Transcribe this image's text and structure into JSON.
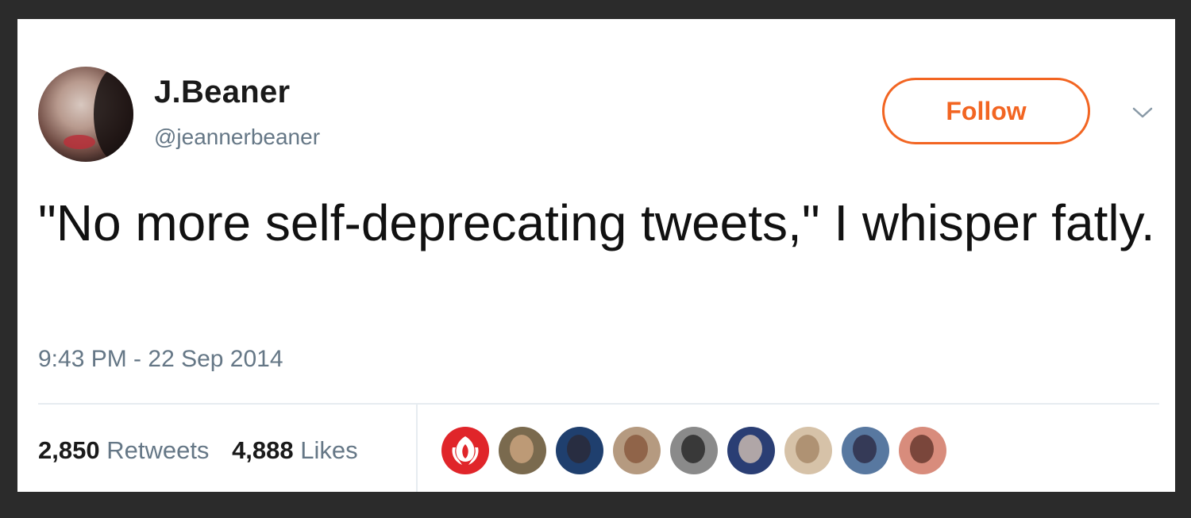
{
  "tweet": {
    "author": {
      "name": "J.Beaner",
      "handle": "@jeannerbeaner"
    },
    "follow_label": "Follow",
    "text": "\"No more self-deprecating tweets,\" I whisper fatly.",
    "timestamp": "9:43 PM - 22 Sep 2014",
    "stats": {
      "retweets_count": "2,850",
      "retweets_label": "Retweets",
      "likes_count": "4,888",
      "likes_label": "Likes"
    },
    "likers": [
      {
        "icon": "rebel-alliance-icon",
        "bg": "#e0252a"
      },
      {
        "icon": "user-avatar",
        "bg": "#7a6a4e",
        "face": "#c9a27e"
      },
      {
        "icon": "user-avatar",
        "bg": "#1f3f6e",
        "face": "#2a2a3a"
      },
      {
        "icon": "user-avatar",
        "bg": "#b59a80",
        "face": "#8a5a40"
      },
      {
        "icon": "user-avatar",
        "bg": "#8a8a8a",
        "face": "#2a2a2a"
      },
      {
        "icon": "user-avatar",
        "bg": "#2a3e74",
        "face": "#c8b8b0"
      },
      {
        "icon": "user-avatar",
        "bg": "#d6c2a8",
        "face": "#a88a6a"
      },
      {
        "icon": "user-avatar",
        "bg": "#5878a0",
        "face": "#2f2f4a"
      },
      {
        "icon": "user-avatar",
        "bg": "#d88c7c",
        "face": "#6a3a30"
      }
    ]
  },
  "colors": {
    "accent": "#f26522",
    "secondary_text": "#657786",
    "page_background": "#2b2b2b"
  }
}
